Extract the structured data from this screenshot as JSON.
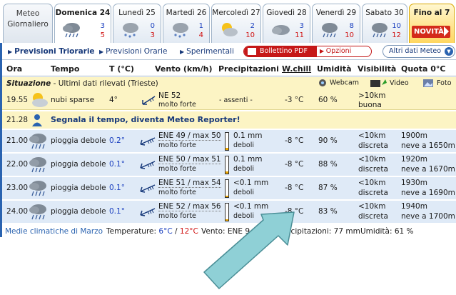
{
  "tabs": [
    {
      "label_l1": "Meteo",
      "label_l2": "Giornaliero",
      "type": "meteo"
    },
    {
      "label": "Domenica 24",
      "min": "3",
      "max": "5",
      "icon": "rain-cloud-icon",
      "active": true
    },
    {
      "label": "Lunedì 25",
      "min": "0",
      "max": "3",
      "icon": "snow-cloud-icon"
    },
    {
      "label": "Martedì 26",
      "min": "1",
      "max": "4",
      "icon": "snow-cloud-icon"
    },
    {
      "label": "Mercoledì 27",
      "min": "2",
      "max": "10",
      "icon": "sun-cloud-icon"
    },
    {
      "label": "Giovedì 28",
      "min": "3",
      "max": "11",
      "icon": "cloud-icon"
    },
    {
      "label": "Venerdì 29",
      "min": "8",
      "max": "10",
      "icon": "rain-cloud-icon"
    },
    {
      "label": "Sabato 30",
      "min": "10",
      "max": "12",
      "icon": "rain-cloud-icon"
    },
    {
      "label": "Fino al 7",
      "badge": "NOVITÀ",
      "type": "fino"
    }
  ],
  "nav": {
    "previsioni_triorarie": "Previsioni Triorarie",
    "previsioni_orarie": "Previsioni Orarie",
    "sperimentali": "Sperimentali",
    "bollettino_pdf": "Bollettino PDF",
    "opzioni": "Opzioni",
    "altri_dati": "Altri dati Meteo"
  },
  "columns": {
    "ora": "Ora",
    "tempo": "Tempo",
    "t": "T (°C)",
    "vento": "Vento (km/h)",
    "precipitazioni": "Precipitazioni",
    "wchill": "W.chill",
    "umidita": "Umidità",
    "visibilita": "Visibilità",
    "quota": "Quota 0°C"
  },
  "situazione": {
    "label": "Situazione",
    "sub": " - Ultimi dati rilevati (Trieste)",
    "webcam": "Webcam",
    "video": "Video",
    "foto": "Foto"
  },
  "current": {
    "ora": "19.55",
    "tempo": "nubi sparse",
    "t": "4°",
    "vento": "NE 52",
    "vento_sub": "molto forte",
    "precipitazioni": "- assenti -",
    "wchill": "-3 °C",
    "umidita": "60 %",
    "visibilita": ">10km",
    "visibilita_sub": "buona"
  },
  "reporter": {
    "ora": "21.28",
    "text": "Segnala il tempo, diventa Meteo Reporter!"
  },
  "forecast": [
    {
      "ora": "21.00",
      "tempo": "pioggia debole",
      "t": "0.2°",
      "vento": "ENE 49 / max 50",
      "vento_sub": "molto forte",
      "prec": "0.1 mm",
      "prec_sub": "deboli",
      "prec_level": 0.12,
      "wchill": "-8 °C",
      "umidita": "90 %",
      "vis": "<10km",
      "vis_sub": "discreta",
      "quota": "1900m",
      "quota_sub": "neve a 1650m"
    },
    {
      "ora": "22.00",
      "tempo": "pioggia debole",
      "t": "0.1°",
      "vento": "ENE 50 / max 51",
      "vento_sub": "molto forte",
      "prec": "0.1 mm",
      "prec_sub": "deboli",
      "prec_level": 0.12,
      "wchill": "-8 °C",
      "umidita": "88 %",
      "vis": "<10km",
      "vis_sub": "discreta",
      "quota": "1920m",
      "quota_sub": "neve a 1670m"
    },
    {
      "ora": "23.00",
      "tempo": "pioggia debole",
      "t": "0.1°",
      "vento": "ENE 51 / max 54",
      "vento_sub": "molto forte",
      "prec": "<0.1 mm",
      "prec_sub": "deboli",
      "prec_level": 0.08,
      "wchill": "-8 °C",
      "umidita": "87 %",
      "vis": "<10km",
      "vis_sub": "discreta",
      "quota": "1930m",
      "quota_sub": "neve a 1690m"
    },
    {
      "ora": "24.00",
      "tempo": "pioggia debole",
      "t": "0.1°",
      "vento": "ENE 52 / max 56",
      "vento_sub": "molto forte",
      "prec": "<0.1 mm",
      "prec_sub": "deboli",
      "prec_level": 0.08,
      "wchill": "-8 °C",
      "umidita": "83 %",
      "vis": "<10km",
      "vis_sub": "discreta",
      "quota": "1940m",
      "quota_sub": "neve a 1700m"
    }
  ],
  "footer": {
    "medie": "Medie climatiche di Marzo",
    "temperature_label": "Temperature:",
    "temp_min": "6°C",
    "sep": " / ",
    "temp_max": "12°C",
    "vento": "Vento: ENE 9",
    "prec": "recipitazioni: 77 mm",
    "umidita": "Umidità: 61 %"
  },
  "colors": {
    "accent_blue": "#2a63b0",
    "row_blue": "#dfeaf7",
    "row_yellow": "#fcf4c4",
    "red": "#c61818",
    "arrow": "#8fd0d6"
  }
}
